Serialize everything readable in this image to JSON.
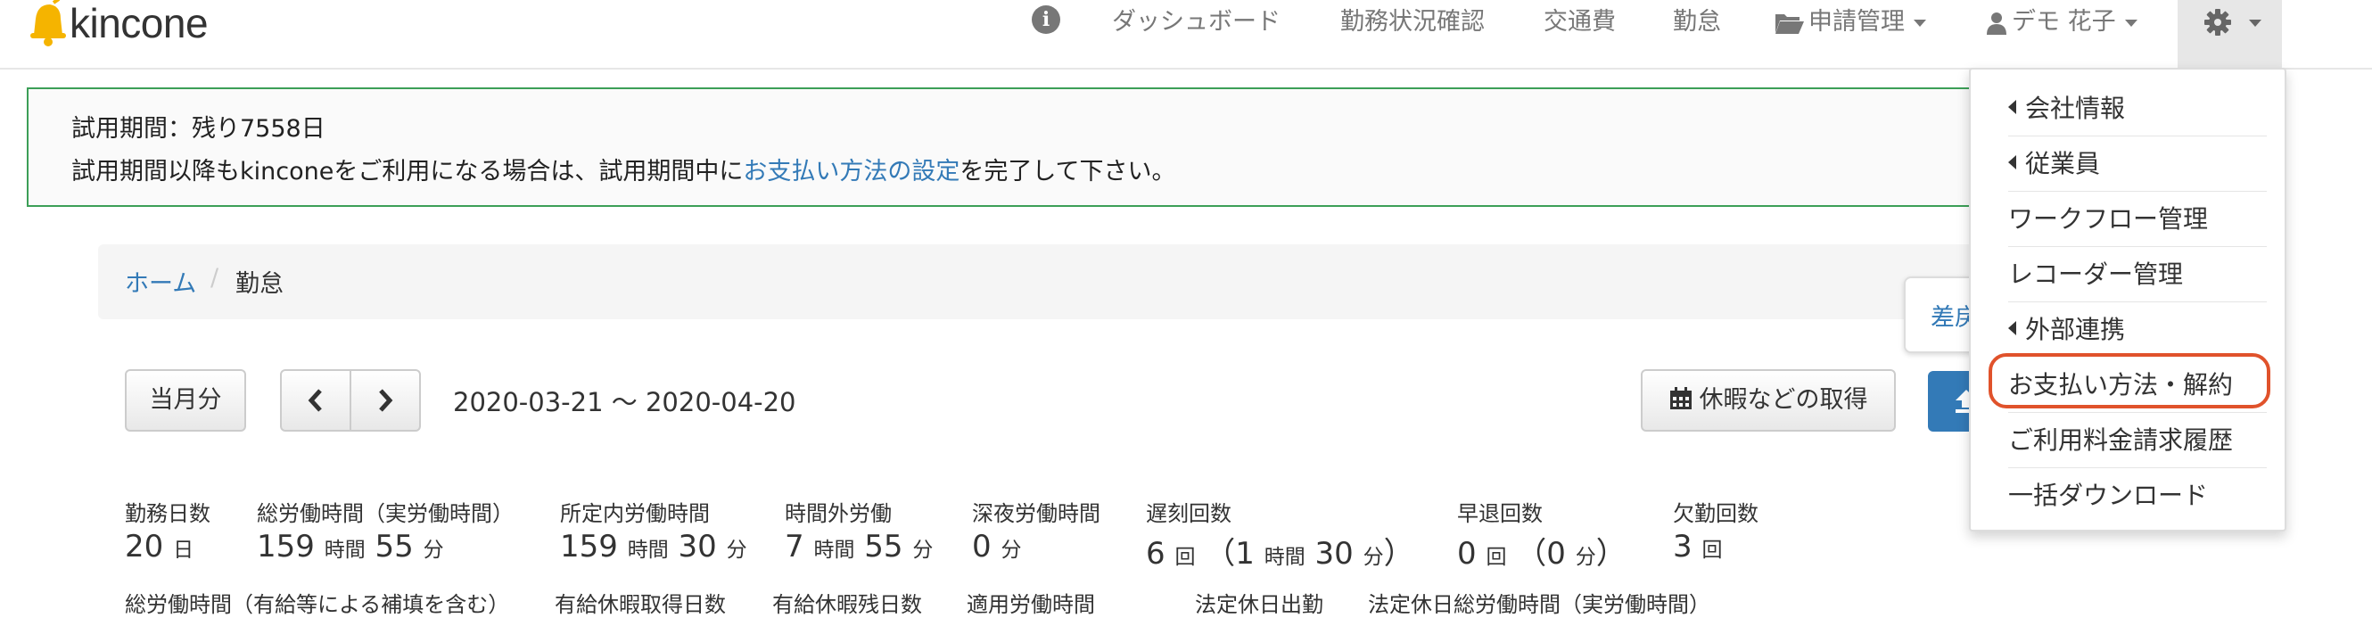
{
  "brand": {
    "name": "kincone",
    "bell_color": "#f5b400"
  },
  "nav": {
    "items": [
      {
        "label": "ダッシュボード"
      },
      {
        "label": "勤務状況確認"
      },
      {
        "label": "交通費"
      },
      {
        "label": "勤怠"
      },
      {
        "label": "申請管理"
      },
      {
        "label": "デモ 花子"
      }
    ]
  },
  "alert": {
    "title": "試用期間：残り7558日",
    "text_before": "試用期間以降もkinconeをご利用になる場合は、試用期間中に",
    "link": "お支払い方法の設定",
    "text_after": "を完了して下さい。"
  },
  "breadcrumb": {
    "home": "ホーム",
    "separator": "/",
    "current": "勤怠"
  },
  "toolbar": {
    "current_month": "当月分",
    "period": "2020-03-21 〜 2020-04-20",
    "leave_button": "休暇などの取得",
    "floating_panel_label": "差戻"
  },
  "stats": {
    "row1": [
      {
        "label": "勤務日数",
        "value": "20",
        "unit": "日"
      },
      {
        "label": "総労働時間（実労働時間）",
        "h": "159",
        "h_unit": "時間",
        "m": "55",
        "m_unit": "分"
      },
      {
        "label": "所定内労働時間",
        "h": "159",
        "h_unit": "時間",
        "m": "30",
        "m_unit": "分"
      },
      {
        "label": "時間外労働",
        "h": "7",
        "h_unit": "時間",
        "m": "55",
        "m_unit": "分"
      },
      {
        "label": "深夜労働時間",
        "value": "0",
        "unit": "分"
      },
      {
        "label": "遅刻回数",
        "value": "6",
        "unit": "回",
        "paren_open": "（1",
        "paren_h_unit": "時間",
        "paren_m": "30",
        "paren_m_unit": "分",
        "paren_close": "）"
      },
      {
        "label": "早退回数",
        "value": "0",
        "unit": "回",
        "paren_open": "（0",
        "paren_m_unit": "分",
        "paren_close": "）"
      },
      {
        "label": "欠勤回数",
        "value": "3",
        "unit": "回"
      }
    ],
    "row3_labels": [
      "総労働時間（有給等による補填を含む）",
      "有給休暇取得日数",
      "有給休暇残日数",
      "適用労働時間",
      "法定休日出勤",
      "法定休日総労働時間（実労働時間）"
    ]
  },
  "settings_menu": {
    "items": [
      {
        "label": "会社情報",
        "submenu": true
      },
      {
        "label": "従業員",
        "submenu": true
      },
      {
        "label": "ワークフロー管理",
        "submenu": false
      },
      {
        "label": "レコーダー管理",
        "submenu": false
      },
      {
        "label": "外部連携",
        "submenu": true
      },
      {
        "label": "お支払い方法・解約",
        "submenu": false,
        "highlighted": true
      },
      {
        "label": "ご利用料金請求履歴",
        "submenu": false
      },
      {
        "label": "一括ダウンロード",
        "submenu": false
      }
    ],
    "highlight_color": "#e0522b"
  },
  "colors": {
    "link": "#337ab7",
    "alert_border": "#3c9f57",
    "primary": "#337ab7"
  }
}
